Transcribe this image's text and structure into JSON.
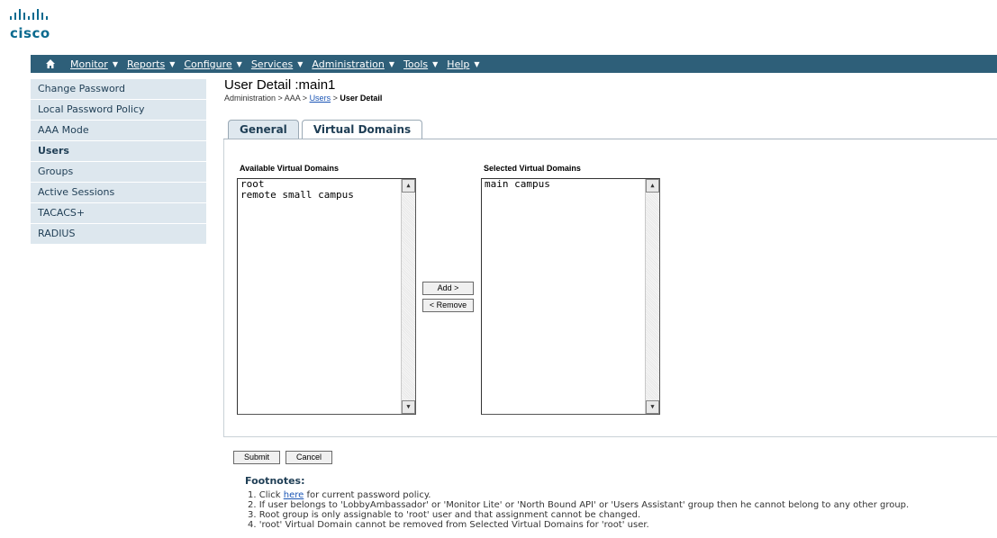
{
  "brand": {
    "name": "cisco",
    "color": "#0b6a8f"
  },
  "nav": {
    "home_icon": "home-icon",
    "items": [
      {
        "label": "Monitor",
        "has_caret": true
      },
      {
        "label": "Reports",
        "has_caret": true
      },
      {
        "label": "Configure",
        "has_caret": true
      },
      {
        "label": "Services",
        "has_caret": true
      },
      {
        "label": "Administration",
        "has_caret": true
      },
      {
        "label": "Tools",
        "has_caret": true
      },
      {
        "label": "Help",
        "has_caret": true
      }
    ],
    "bg_color": "#2e5f79"
  },
  "sidebar": {
    "items": [
      {
        "label": "Change Password",
        "active": false
      },
      {
        "label": "Local Password Policy",
        "active": false
      },
      {
        "label": "AAA Mode",
        "active": false
      },
      {
        "label": "Users",
        "active": true
      },
      {
        "label": "Groups",
        "active": false
      },
      {
        "label": "Active Sessions",
        "active": false
      },
      {
        "label": "TACACS+",
        "active": false
      },
      {
        "label": "RADIUS",
        "active": false
      }
    ]
  },
  "page": {
    "title": "User Detail :main1",
    "breadcrumb": {
      "part1": "Administration > AAA > ",
      "link": "Users",
      "sep": " > ",
      "current": "User Detail"
    }
  },
  "tabs": [
    {
      "label": "General",
      "active": false
    },
    {
      "label": "Virtual Domains",
      "active": true
    }
  ],
  "domains": {
    "available_label": "Available Virtual Domains",
    "selected_label": "Selected Virtual Domains",
    "available": [
      "root",
      "remote small campus"
    ],
    "selected": [
      "main campus"
    ],
    "add_label": "Add >",
    "remove_label": "< Remove"
  },
  "actions": {
    "submit_label": "Submit",
    "cancel_label": "Cancel"
  },
  "footnotes": {
    "title": "Footnotes:",
    "line1_pre": "1. Click ",
    "line1_link": "here",
    "line1_post": " for current password policy.",
    "line2": "2. If user belongs to 'LobbyAmbassador' or 'Monitor Lite' or 'North Bound API' or 'Users Assistant' group then he cannot belong to any other group.",
    "line3": "3. Root group is only assignable to 'root' user and that assignment cannot be changed.",
    "line4": "4. 'root' Virtual Domain cannot be removed from Selected Virtual Domains for 'root' user."
  }
}
